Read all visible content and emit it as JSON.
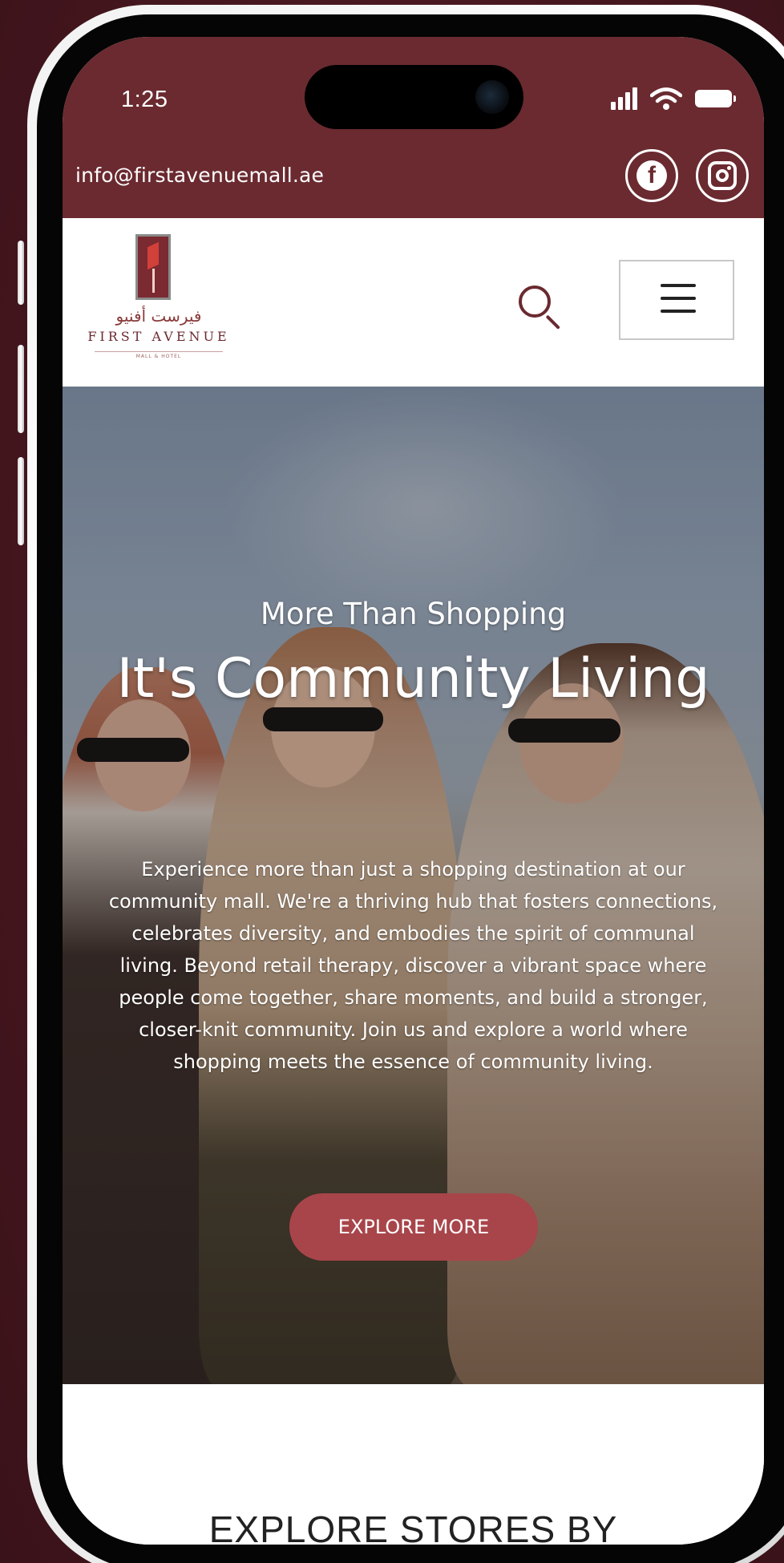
{
  "status_bar": {
    "time": "1:25"
  },
  "topbar": {
    "email": "info@firstavenuemall.ae",
    "social": [
      {
        "icon": "facebook-icon"
      },
      {
        "icon": "instagram-icon"
      }
    ]
  },
  "header": {
    "logo_arabic": "فيرست أفنيو",
    "logo_name": "FIRST AVENUE",
    "logo_tagline": "MALL & HOTEL",
    "search_icon": "search-icon",
    "menu_icon": "hamburger-menu-icon"
  },
  "hero": {
    "kicker": "More Than Shopping",
    "title": "It's Community Living",
    "body": "Experience more than just a shopping destination at our community mall. We're a thriving hub that fosters connections, celebrates diversity, and embodies the spirit of communal living. Beyond retail therapy, discover a vibrant space where people come together, share moments, and build a stronger, closer-knit community. Join us and explore a world where shopping meets the essence of community living.",
    "cta_label": "EXPLORE MORE"
  },
  "explore": {
    "title": "EXPLORE STORES BY"
  },
  "colors": {
    "brand_maroon": "#6a2a30",
    "cta_red": "#a8454a",
    "background": "#4a1a22"
  }
}
